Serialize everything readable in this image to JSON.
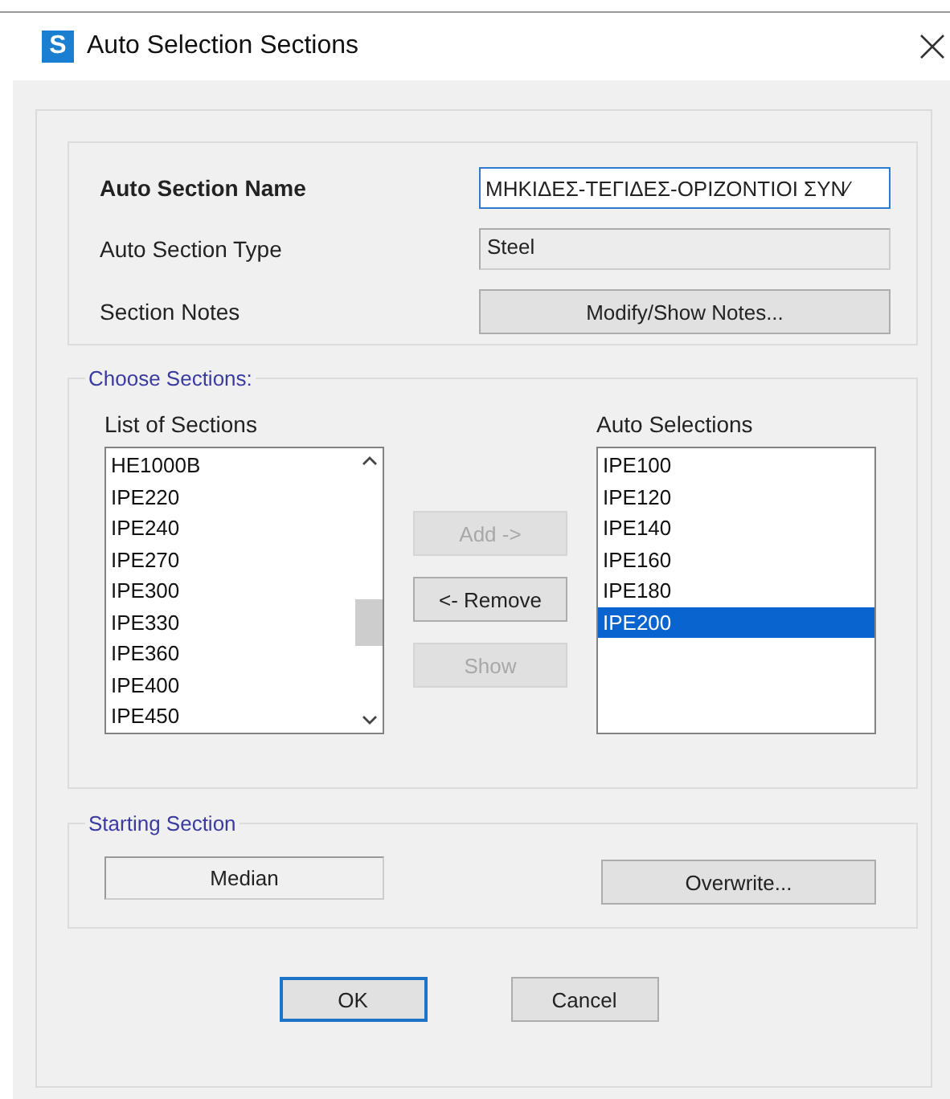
{
  "window": {
    "logo": "S",
    "title": "Auto Selection Sections"
  },
  "properties": {
    "name_label": "Auto Section Name",
    "name_value": "ΜΗΚΙΔΕΣ-ΤΕΓΙΔΕΣ-ΟΡΙΖΟΝΤΙΟΙ ΣΥΝ⁄",
    "type_label": "Auto Section Type",
    "type_value": "Steel",
    "notes_label": "Section Notes",
    "notes_button": "Modify/Show Notes..."
  },
  "choose_sections": {
    "legend": "Choose Sections:",
    "list_label": "List of Sections",
    "list_items": [
      {
        "label": "HE1000B",
        "selected": false
      },
      {
        "label": "IPE220",
        "selected": false
      },
      {
        "label": "IPE240",
        "selected": false
      },
      {
        "label": "IPE270",
        "selected": false
      },
      {
        "label": "IPE300",
        "selected": false
      },
      {
        "label": "IPE330",
        "selected": false
      },
      {
        "label": "IPE360",
        "selected": false
      },
      {
        "label": "IPE400",
        "selected": false
      },
      {
        "label": "IPE450",
        "selected": false
      }
    ],
    "buttons": [
      {
        "label": "Add ->",
        "disabled": true
      },
      {
        "label": "<- Remove",
        "disabled": false
      },
      {
        "label": "Show",
        "disabled": true
      }
    ],
    "auto_label": "Auto Selections",
    "auto_items": [
      {
        "label": "IPE100",
        "selected": false
      },
      {
        "label": "IPE120",
        "selected": false
      },
      {
        "label": "IPE140",
        "selected": false
      },
      {
        "label": "IPE160",
        "selected": false
      },
      {
        "label": "IPE180",
        "selected": false
      },
      {
        "label": "IPE200",
        "selected": true
      }
    ]
  },
  "starting_section": {
    "legend": "Starting Section",
    "value": "Median",
    "button": "Overwrite..."
  },
  "buttons": [
    {
      "label": "OK",
      "default": true
    },
    {
      "label": "Cancel",
      "default": false
    }
  ]
}
